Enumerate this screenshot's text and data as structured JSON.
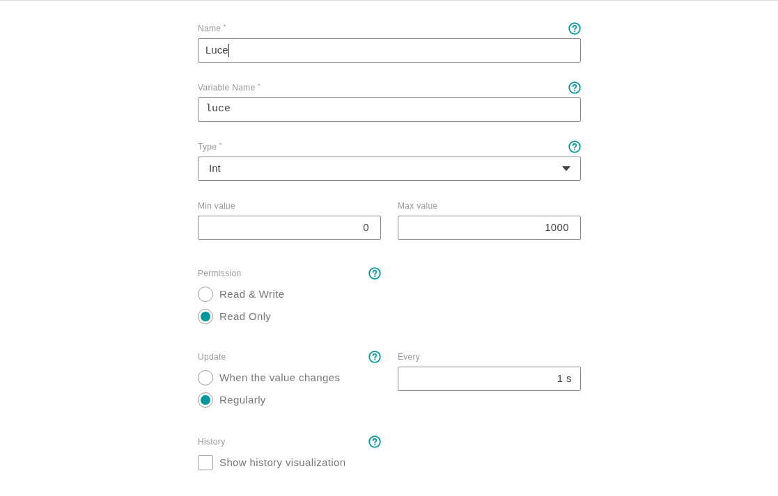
{
  "fields": [
    {
      "label": "Name $^{*}$",
      "value": "Luce",
      "kind": "text",
      "focused": true
    },
    {
      "label": "Variable Name $^{*}$",
      "value": "luce",
      "kind": "code"
    },
    {
      "label": "Type $^{*}$",
      "value": "Int",
      "kind": "select"
    }
  ],
  "range": [
    {
      "label": "Min value",
      "value": "0"
    },
    {
      "label": "Max value",
      "value": "1000"
    }
  ],
  "permission": {
    "label": "Permission",
    "options": [
      {
        "label": "Read & Write",
        "selected": false
      },
      {
        "label": "Read Only",
        "selected": true
      }
    ]
  },
  "update": {
    "label": "Update",
    "options": [
      {
        "label": "When the value changes",
        "selected": false
      },
      {
        "label": "Regularly",
        "selected": true
      }
    ],
    "every": {
      "label": "Every",
      "value": "1 s"
    }
  },
  "history": {
    "label": "History",
    "option": {
      "label": "Show history visualization",
      "checked": false
    }
  }
}
